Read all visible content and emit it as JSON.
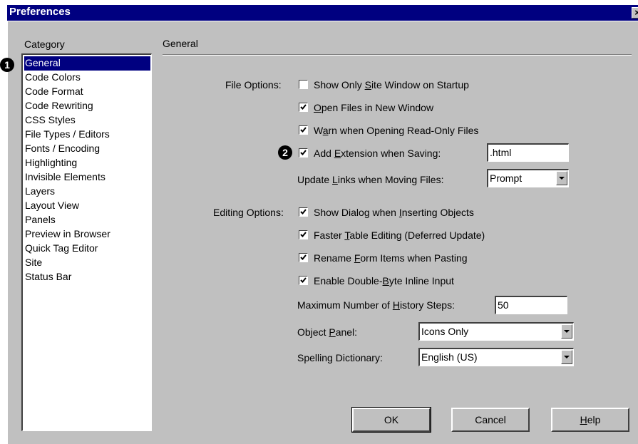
{
  "window": {
    "title": "Preferences",
    "close_glyph": "×"
  },
  "category": {
    "label": "Category",
    "items": [
      {
        "label": "General",
        "selected": true
      },
      {
        "label": "Code Colors"
      },
      {
        "label": "Code Format"
      },
      {
        "label": "Code Rewriting"
      },
      {
        "label": "CSS Styles"
      },
      {
        "label": "File Types / Editors"
      },
      {
        "label": "Fonts / Encoding"
      },
      {
        "label": "Highlighting"
      },
      {
        "label": "Invisible Elements"
      },
      {
        "label": "Layers"
      },
      {
        "label": "Layout View"
      },
      {
        "label": "Panels"
      },
      {
        "label": "Preview in Browser"
      },
      {
        "label": "Quick Tag Editor"
      },
      {
        "label": "Site"
      },
      {
        "label": "Status Bar"
      }
    ]
  },
  "panel": {
    "title": "General"
  },
  "file_options": {
    "label": "File Options:",
    "show_site_window": {
      "pre": "Show Only ",
      "key": "S",
      "post": "ite Window on Startup",
      "checked": false
    },
    "open_new_window": {
      "pre": "",
      "key": "O",
      "post": "pen Files in New Window",
      "checked": true
    },
    "warn_readonly": {
      "pre": "W",
      "key": "a",
      "post": "rn when Opening Read-Only Files",
      "checked": true
    },
    "add_extension": {
      "pre": "Add ",
      "key": "E",
      "post": "xtension when Saving:",
      "checked": true,
      "value": ".html"
    },
    "update_links": {
      "pre": "Update ",
      "key": "L",
      "post": "inks when Moving Files:",
      "value": "Prompt"
    }
  },
  "editing_options": {
    "label": "Editing Options:",
    "show_dialog": {
      "pre": "Show Dialog when ",
      "key": "I",
      "post": "nserting Objects",
      "checked": true
    },
    "faster_table": {
      "pre": "Faster ",
      "key": "T",
      "post": "able Editing (Deferred Update)",
      "checked": true
    },
    "rename_form": {
      "pre": "Rename ",
      "key": "F",
      "post": "orm Items when Pasting",
      "checked": true
    },
    "double_byte": {
      "pre": "Enable Double-",
      "key": "B",
      "post": "yte Inline Input",
      "checked": true
    },
    "history_steps": {
      "pre": "Maximum Number of ",
      "key": "H",
      "post": "istory Steps:",
      "value": "50"
    },
    "object_panel": {
      "pre": "Object ",
      "key": "P",
      "post": "anel:",
      "value": "Icons Only"
    },
    "spelling": {
      "pre": "Spellin",
      "key": "g",
      "post": " Dictionary:",
      "value": "English (US)"
    }
  },
  "buttons": {
    "ok": {
      "label": "OK"
    },
    "cancel": {
      "label": "Cancel"
    },
    "help": {
      "pre": "",
      "key": "H",
      "post": "elp"
    }
  },
  "markers": {
    "one": "1",
    "two": "2"
  },
  "icons": {
    "checkbox": "check-icon",
    "dropdown": "dropdown-arrow-icon",
    "close": "close-icon"
  }
}
